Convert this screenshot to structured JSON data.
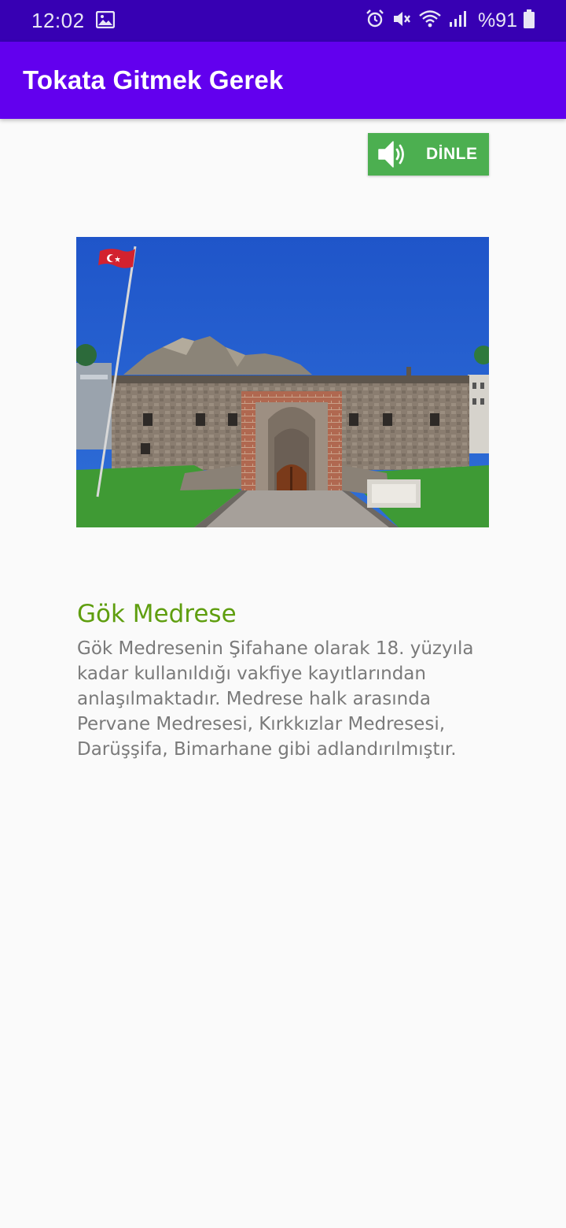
{
  "status_bar": {
    "time": "12:02",
    "battery": "%91"
  },
  "app_bar": {
    "title": "Tokata Gitmek Gerek"
  },
  "listen_button": {
    "label": "DİNLE"
  },
  "place": {
    "title": "Gök Medrese",
    "description": "Gök Medresenin Şifahane olarak 18. yüzyıla kadar kullanıldığı vakfiye kayıtlarından anlaşılmaktadır. Medrese halk arasında Pervane Medresesi, Kırkkızlar Medresesi, Darüşşifa, Bimarhane gibi adlandırılmıştır."
  },
  "colors": {
    "status_bar": "#3700b3",
    "app_bar": "#6200ee",
    "listen_button": "#4caf50",
    "title_text": "#5f9e0f",
    "body_text": "#7a7a7a",
    "background": "#fafafa"
  }
}
